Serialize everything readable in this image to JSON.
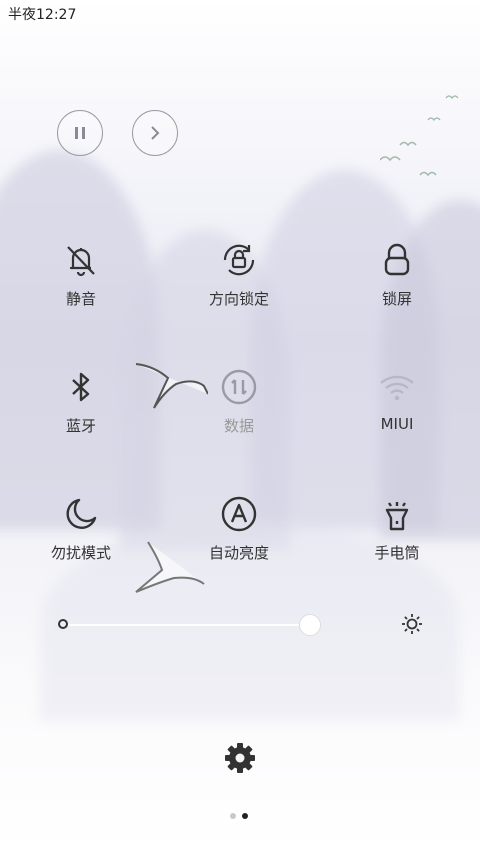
{
  "status_bar": {
    "time": "半夜12:27"
  },
  "media": {
    "pause_icon": "pause-icon",
    "next_icon": "next-icon"
  },
  "tiles": [
    {
      "label": "静音",
      "icon": "bell-off-icon"
    },
    {
      "label": "方向锁定",
      "icon": "rotation-lock-icon"
    },
    {
      "label": "锁屏",
      "icon": "lock-icon"
    },
    {
      "label": "蓝牙",
      "icon": "bluetooth-icon"
    },
    {
      "label": "数据",
      "icon": "mobile-data-icon"
    },
    {
      "label": "MIUI",
      "icon": "wifi-icon"
    },
    {
      "label": "勿扰模式",
      "icon": "moon-icon"
    },
    {
      "label": "自动亮度",
      "icon": "auto-brightness-icon"
    },
    {
      "label": "手电筒",
      "icon": "flashlight-icon"
    }
  ],
  "brightness": {
    "level": 0.93,
    "min_icon": "brightness-low-icon",
    "max_icon": "brightness-high-icon"
  },
  "settings": {
    "icon": "gear-icon"
  },
  "pager": {
    "pages": 2,
    "current": 2
  },
  "colors": {
    "icon": "#333333",
    "icon_dim": "#9a9aa6",
    "label_dim": "#999999"
  }
}
